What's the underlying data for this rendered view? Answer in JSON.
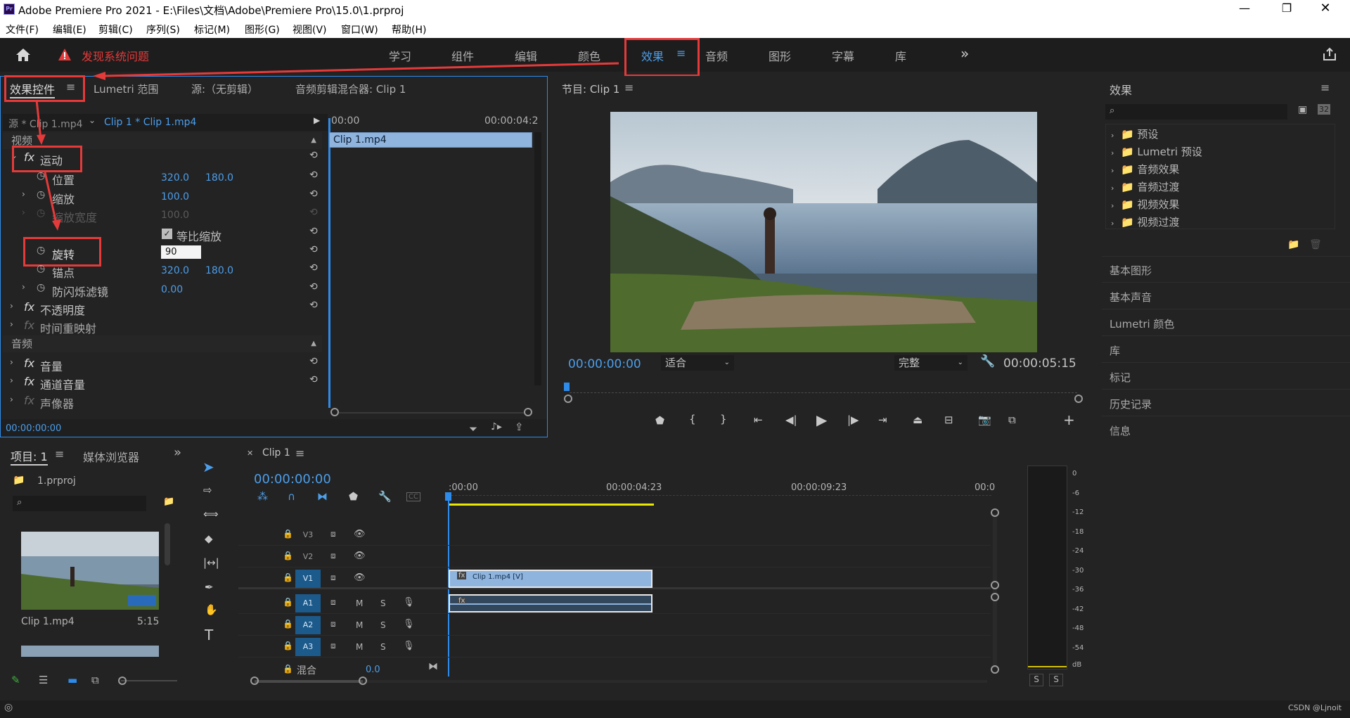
{
  "window": {
    "title": "Adobe Premiere Pro 2021 - E:\\Files\\文档\\Adobe\\Premiere Pro\\15.0\\1.prproj",
    "app_badge": "Pr"
  },
  "menu": [
    "文件(F)",
    "编辑(E)",
    "剪辑(C)",
    "序列(S)",
    "标记(M)",
    "图形(G)",
    "视图(V)",
    "窗口(W)",
    "帮助(H)"
  ],
  "workspace": {
    "alert": "发现系统问题",
    "tabs": [
      "学习",
      "组件",
      "编辑",
      "颜色",
      "效果",
      "音频",
      "图形",
      "字幕",
      "库"
    ],
    "active_tab": "效果",
    "more": "»"
  },
  "effect_controls": {
    "tabs": [
      "效果控件",
      "Lumetri 范围",
      "源:（无剪辑）",
      "音频剪辑混合器: Clip 1"
    ],
    "source": "源 * Clip 1.mp4",
    "clip": "Clip 1 * Clip 1.mp4",
    "time_start": "00:00",
    "time_end": "00:00:04:2",
    "clip_bar": "Clip 1.mp4",
    "video_section": "视频",
    "audio_section": "音频",
    "fx_label": "fx",
    "motion": "运动",
    "position_label": "位置",
    "position_x": "320.0",
    "position_y": "180.0",
    "scale_label": "缩放",
    "scale_value": "100.0",
    "scale_width_label": "缩放宽度",
    "scale_width_value": "100.0",
    "uniform_label": "等比缩放",
    "rotation_label": "旋转",
    "rotation_value": "90",
    "anchor_label": "锚点",
    "anchor_x": "320.0",
    "anchor_y": "180.0",
    "flicker_label": "防闪烁滤镜",
    "flicker_value": "0.00",
    "opacity": "不透明度",
    "time_remap": "时间重映射",
    "volume": "音量",
    "channel_volume": "通道音量",
    "panner": "声像器",
    "footer_time": "00:00:00:00"
  },
  "program": {
    "title": "节目: Clip 1",
    "timecode": "00:00:00:00",
    "fit": "适合",
    "quality": "完整",
    "duration": "00:00:05:15"
  },
  "project": {
    "tabs": [
      "项目: 1",
      "媒体浏览器"
    ],
    "file": "1.prproj",
    "clip_name": "Clip 1.mp4",
    "clip_duration": "5:15"
  },
  "timeline": {
    "tab": "Clip 1",
    "timecode": "00:00:00:00",
    "ruler": [
      ":00:00",
      "00:00:04:23",
      "00:00:09:23",
      "00:0"
    ],
    "video_tracks": [
      "V3",
      "V2",
      "V1"
    ],
    "audio_tracks": [
      "A1",
      "A2",
      "A3"
    ],
    "mix_label": "混合",
    "mix_value": "0.0",
    "video_clip": "Clip 1.mp4 [V]",
    "m": "M",
    "s": "S",
    "cc": "CC"
  },
  "effects_panel": {
    "title": "效果",
    "items": [
      "预设",
      "Lumetri 预设",
      "音频效果",
      "音频过渡",
      "视频效果",
      "视频过渡"
    ],
    "sections": [
      "基本图形",
      "基本声音",
      "Lumetri 颜色",
      "库",
      "标记",
      "历史记录",
      "信息"
    ]
  },
  "meter": {
    "scale": [
      "0",
      "-6",
      "-12",
      "-18",
      "-24",
      "-30",
      "-36",
      "-42",
      "-48",
      "-54",
      "dB"
    ],
    "solo": "S"
  },
  "watermark": "CSDN @Ljnoit"
}
